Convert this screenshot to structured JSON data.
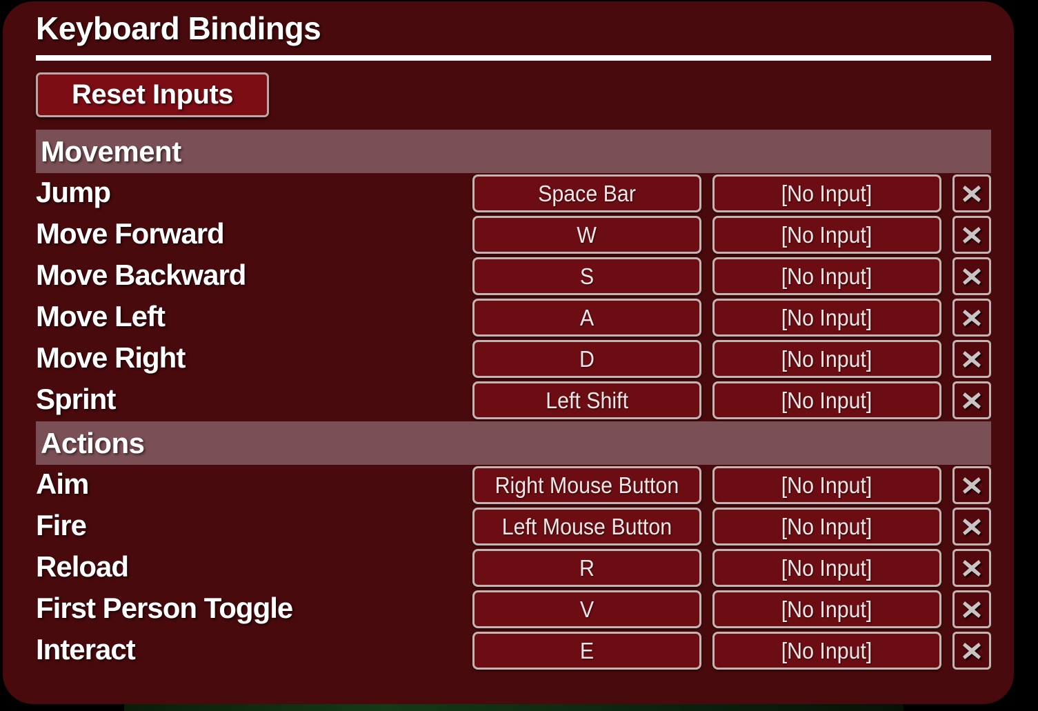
{
  "panel": {
    "title": "Keyboard Bindings",
    "reset_label": "Reset Inputs",
    "clear_icon": "close-x-icon",
    "empty_binding": "[No Input]",
    "colors": {
      "panel_background": "#480A0C",
      "section_header": "#7A4F55",
      "button_fill": "#6B0D12",
      "reset_button_fill": "#7D0D14",
      "clear_button_fill": "#52080C",
      "border": "#C4B5B5",
      "text": "#FFFFFF",
      "binding_text": "#EFE7E7",
      "scrollbar": "#FFFFFF"
    }
  },
  "sections": [
    {
      "header": "Movement",
      "rows": [
        {
          "action": "Jump",
          "primary": "Space Bar",
          "secondary": "[No Input]"
        },
        {
          "action": "Move Forward",
          "primary": "W",
          "secondary": "[No Input]"
        },
        {
          "action": "Move Backward",
          "primary": "S",
          "secondary": "[No Input]"
        },
        {
          "action": "Move Left",
          "primary": "A",
          "secondary": "[No Input]"
        },
        {
          "action": "Move Right",
          "primary": "D",
          "secondary": "[No Input]"
        },
        {
          "action": "Sprint",
          "primary": "Left Shift",
          "secondary": "[No Input]"
        }
      ]
    },
    {
      "header": "Actions",
      "rows": [
        {
          "action": "Aim",
          "primary": "Right Mouse Button",
          "secondary": "[No Input]"
        },
        {
          "action": "Fire",
          "primary": "Left Mouse Button",
          "secondary": "[No Input]"
        },
        {
          "action": "Reload",
          "primary": "R",
          "secondary": "[No Input]"
        },
        {
          "action": "First Person Toggle",
          "primary": "V",
          "secondary": "[No Input]"
        },
        {
          "action": "Interact",
          "primary": "E",
          "secondary": "[No Input]"
        }
      ]
    }
  ]
}
